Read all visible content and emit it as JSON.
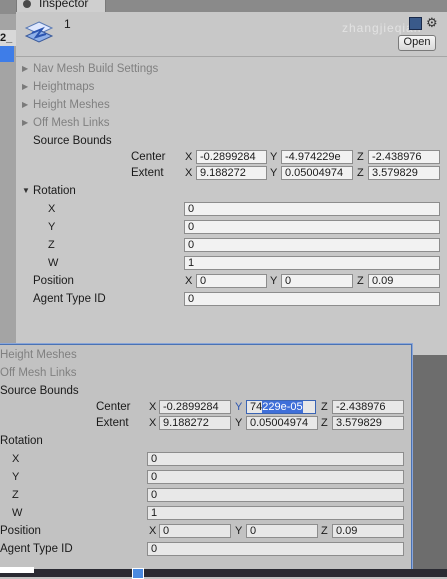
{
  "left": {
    "label": "2_"
  },
  "tab": {
    "title": "Inspector"
  },
  "header": {
    "object_name": "1",
    "watermark": "zhangjieqian",
    "open_label": "Open"
  },
  "sections": {
    "nav_mesh_build_settings": "Nav Mesh Build Settings",
    "heightmaps": "Heightmaps",
    "height_meshes": "Height Meshes",
    "off_mesh_links": "Off Mesh Links",
    "source_bounds": "Source Bounds",
    "rotation": "Rotation",
    "position": "Position",
    "agent_type_id": "Agent Type ID"
  },
  "labels": {
    "center": "Center",
    "extent": "Extent",
    "x": "X",
    "y": "Y",
    "z": "Z",
    "w": "W"
  },
  "main": {
    "center": {
      "x": "-0.2899284",
      "y": "-4.974229e",
      "z": "-2.438976"
    },
    "extent": {
      "x": "9.188272",
      "y": "0.05004974",
      "z": "3.579829"
    },
    "rotation": {
      "x": "0",
      "y": "0",
      "z": "0",
      "w": "1"
    },
    "position": {
      "x": "0",
      "y": "0",
      "z": "0.09"
    },
    "agent_type_id": "0"
  },
  "float": {
    "center": {
      "x": "-0.2899284",
      "y_plain": "74",
      "y_selected": "229e-05",
      "z": "-2.438976"
    },
    "extent": {
      "x": "9.188272",
      "y": "0.05004974",
      "z": "3.579829"
    },
    "rotation": {
      "x": "0",
      "y": "0",
      "z": "0",
      "w": "1"
    },
    "position": {
      "x": "0",
      "y": "0",
      "z": "0.09"
    },
    "agent_type_id": "0"
  }
}
